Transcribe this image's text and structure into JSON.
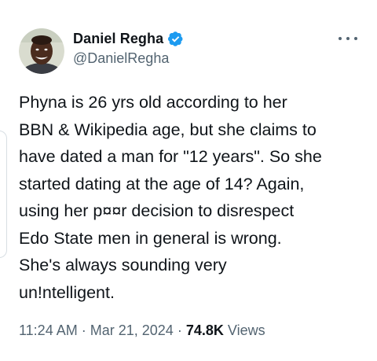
{
  "author": {
    "display_name": "Daniel Regha",
    "handle": "@DanielRegha",
    "verified": true,
    "verified_color": "#1d9bf0"
  },
  "tweet": {
    "text": "Phyna is 26 yrs old according to her\nBBN & Wikipedia age, but she claims to\nhave dated a man for \"12 years\". So she\nstarted dating at the age of 14? Again,\nusing her p¤¤r decision to disrespect\nEdo State men in general is wrong.\nShe's always  sounding very\nun!ntelligent."
  },
  "meta": {
    "time": "11:24 AM",
    "separator": "·",
    "date": "Mar 21, 2024",
    "views_count": "74.8K",
    "views_label": "Views"
  },
  "icons": {
    "more": "more-options-icon",
    "verified": "verified-badge-icon"
  }
}
